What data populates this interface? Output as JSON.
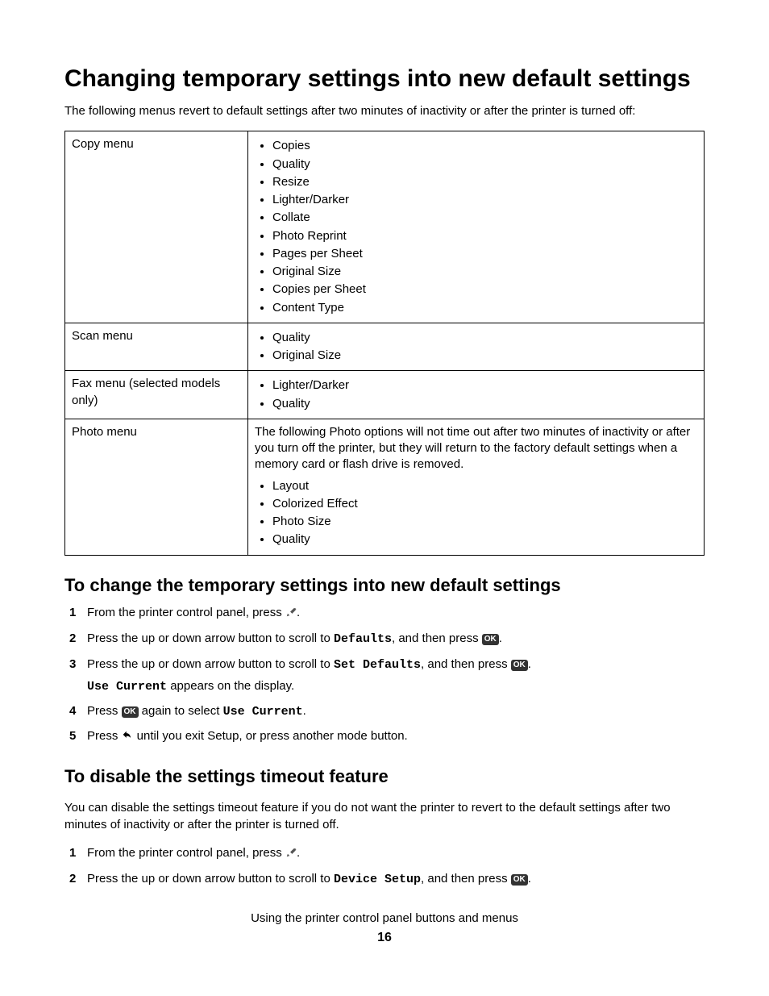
{
  "title": "Changing temporary settings into new default settings",
  "intro": "The following menus revert to default settings after two minutes of inactivity or after the printer is turned off:",
  "table": {
    "rows": [
      {
        "label": "Copy menu",
        "items": [
          "Copies",
          "Quality",
          "Resize",
          "Lighter/Darker",
          "Collate",
          "Photo Reprint",
          "Pages per Sheet",
          "Original Size",
          "Copies per Sheet",
          "Content Type"
        ]
      },
      {
        "label": "Scan menu",
        "items": [
          "Quality",
          "Original Size"
        ]
      },
      {
        "label": "Fax menu (selected models only)",
        "items": [
          "Lighter/Darker",
          "Quality"
        ]
      },
      {
        "label": "Photo menu",
        "note": "The following Photo options will not time out after two minutes of inactivity or after you turn off the printer, but they will return to the factory default settings when a memory card or flash drive is removed.",
        "items": [
          "Layout",
          "Colorized Effect",
          "Photo Size",
          "Quality"
        ]
      }
    ]
  },
  "section1": {
    "heading": "To change the temporary settings into new default settings",
    "steps": {
      "s1a": "From the printer control panel, press ",
      "s1b": ".",
      "s2a": "Press the up or down arrow button to scroll to ",
      "s2b": "Defaults",
      "s2c": ", and then press ",
      "s2d": ".",
      "s3a": "Press the up or down arrow button to scroll to ",
      "s3b": "Set Defaults",
      "s3c": ", and then press ",
      "s3d": ".",
      "s3e": "Use Current",
      "s3f": " appears on the display.",
      "s4a": "Press ",
      "s4b": " again to select ",
      "s4c": "Use Current",
      "s4d": ".",
      "s5a": "Press ",
      "s5b": " until you exit Setup, or press another mode button."
    }
  },
  "section2": {
    "heading": "To disable the settings timeout feature",
    "intro": "You can disable the settings timeout feature if you do not want the printer to revert to the default settings after two minutes of inactivity or after the printer is turned off.",
    "steps": {
      "s1a": "From the printer control panel, press ",
      "s1b": ".",
      "s2a": "Press the up or down arrow button to scroll to ",
      "s2b": "Device Setup",
      "s2c": ", and then press ",
      "s2d": "."
    }
  },
  "footer": {
    "title": "Using the printer control panel buttons and menus",
    "page": "16"
  },
  "ok_label": "OK"
}
